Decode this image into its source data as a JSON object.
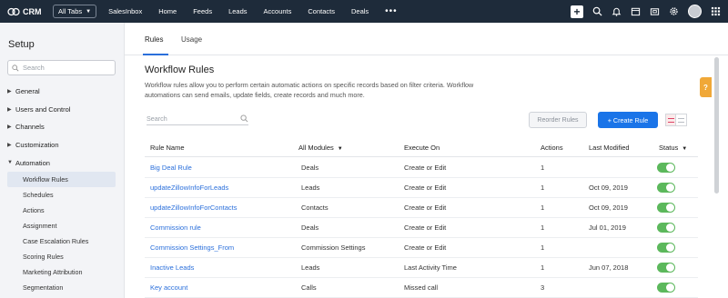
{
  "topbar": {
    "brand": "CRM",
    "all_tabs": "All Tabs",
    "nav": [
      "SalesInbox",
      "Home",
      "Feeds",
      "Leads",
      "Accounts",
      "Contacts",
      "Deals"
    ],
    "more": "•••",
    "icons": [
      "plus-icon",
      "search-icon",
      "bell-icon",
      "calendar-icon",
      "mail-icon",
      "gear-icon",
      "avatar",
      "apps-grid-icon"
    ]
  },
  "sidebar": {
    "title": "Setup",
    "search_placeholder": "Search",
    "categories": [
      {
        "label": "General",
        "expanded": false
      },
      {
        "label": "Users and Control",
        "expanded": false
      },
      {
        "label": "Channels",
        "expanded": false
      },
      {
        "label": "Customization",
        "expanded": false
      },
      {
        "label": "Automation",
        "expanded": true
      }
    ],
    "automation_items": [
      "Workflow Rules",
      "Schedules",
      "Actions",
      "Assignment",
      "Case Escalation Rules",
      "Scoring Rules",
      "Marketing Attribution",
      "Segmentation"
    ],
    "active_item": "Workflow Rules"
  },
  "main": {
    "tabs": [
      "Rules",
      "Usage"
    ],
    "active_tab": "Rules",
    "title": "Workflow Rules",
    "description": "Workflow rules allow you to perform certain automatic actions on specific records based on filter criteria. Workflow automations can send emails, update fields, create records and much more.",
    "search_placeholder": "Search",
    "reorder_label": "Reorder Rules",
    "create_label": "+ Create Rule",
    "help_label": "?",
    "table": {
      "headers": {
        "rule_name": "Rule Name",
        "module": "All Modules",
        "execute_on": "Execute On",
        "actions": "Actions",
        "last_modified": "Last Modified",
        "status": "Status"
      },
      "rows": [
        {
          "name": "Big Deal Rule",
          "module": "Deals",
          "execute_on": "Create or Edit",
          "actions": "1",
          "last_modified": "",
          "status": true
        },
        {
          "name": "updateZillowInfoForLeads",
          "module": "Leads",
          "execute_on": "Create or Edit",
          "actions": "1",
          "last_modified": "Oct 09, 2019",
          "status": true
        },
        {
          "name": "updateZillowInfoForContacts",
          "module": "Contacts",
          "execute_on": "Create or Edit",
          "actions": "1",
          "last_modified": "Oct 09, 2019",
          "status": true
        },
        {
          "name": "Commission rule",
          "module": "Deals",
          "execute_on": "Create or Edit",
          "actions": "1",
          "last_modified": "Jul 01, 2019",
          "status": true
        },
        {
          "name": "Commission Settings_From",
          "module": "Commission Settings",
          "execute_on": "Create or Edit",
          "actions": "1",
          "last_modified": "",
          "status": true
        },
        {
          "name": "Inactive Leads",
          "module": "Leads",
          "execute_on": "Last Activity Time",
          "actions": "1",
          "last_modified": "Jun 07, 2018",
          "status": true
        },
        {
          "name": "Key account",
          "module": "Calls",
          "execute_on": "Missed call",
          "actions": "3",
          "last_modified": "",
          "status": true
        }
      ]
    }
  },
  "colors": {
    "topbar": "#1e2b3a",
    "accent": "#1a74e8",
    "link": "#2a6fdb",
    "toggle_on": "#5cb85c",
    "help": "#f0a838"
  }
}
